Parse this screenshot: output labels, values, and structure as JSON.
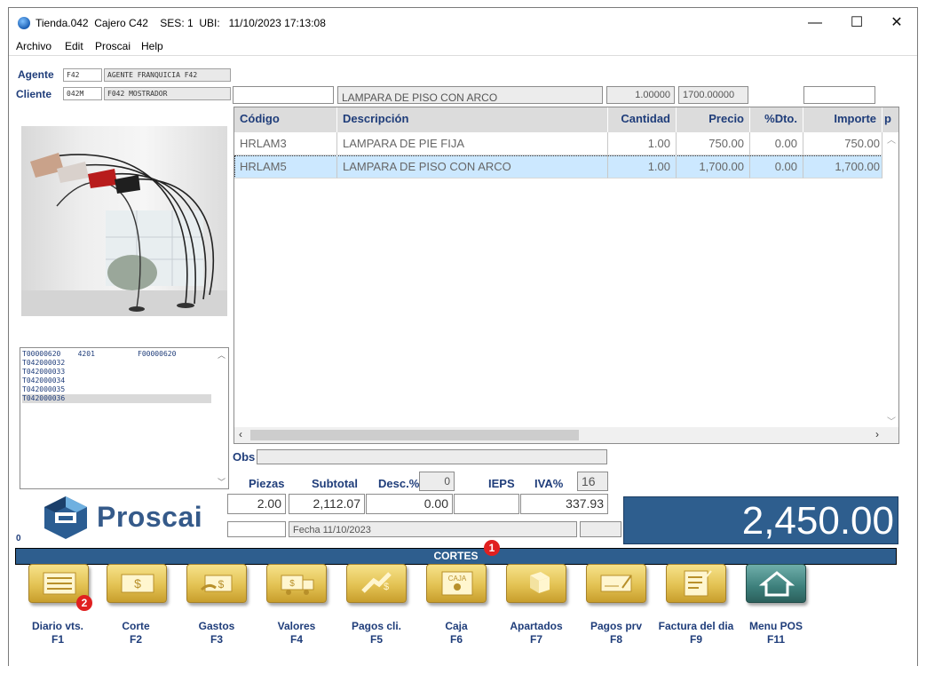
{
  "window": {
    "title": "Tienda.042  Cajero C42    SES: 1  UBI:   11/10/2023 17:13:08",
    "minimize": "—",
    "maximize": "☐",
    "close": "✕"
  },
  "menu": [
    "Archivo",
    "Edit",
    "Proscai",
    "Help"
  ],
  "header": {
    "agente_label": "Agente",
    "agente_code": "F42",
    "agente_name": "AGENTE FRANQUICIA F42",
    "cliente_label": "Cliente",
    "cliente_code": "042M",
    "cliente_name": "F042 MOSTRADOR"
  },
  "item_entry": {
    "code": "",
    "description": "LAMPARA DE PISO CON ARCO",
    "quantity": "1.00000",
    "price": "1700.00000",
    "extra": ""
  },
  "grid": {
    "columns": [
      "Código",
      "Descripción",
      "Cantidad",
      "Precio",
      "%Dto.",
      "Importe",
      "p"
    ],
    "rows": [
      {
        "codigo": "HRLAM3",
        "descripcion": "LAMPARA DE PIE FIJA",
        "cantidad": "1.00",
        "precio": "750.00",
        "dto": "0.00",
        "importe": "750.00"
      },
      {
        "codigo": "HRLAM5",
        "descripcion": "LAMPARA DE PISO CON ARCO",
        "cantidad": "1.00",
        "precio": "1,700.00",
        "dto": "0.00",
        "importe": "1,700.00"
      }
    ]
  },
  "tickets": [
    "T00000620    4201          F00000620",
    "T042000032",
    "T042000033",
    "T042000034",
    "T042000035",
    "T042000036"
  ],
  "obs_label": "Obs",
  "obs_value": "",
  "totals": {
    "piezas_label": "Piezas",
    "subtotal_label": "Subtotal",
    "desc_label": "Desc.%",
    "desc_pct": "0",
    "ieps_label": "IEPS",
    "iva_label": "IVA%",
    "iva_pct": "16",
    "piezas": "2.00",
    "subtotal": "2,112.07",
    "descuento": "0.00",
    "ieps": "",
    "iva": "337.93",
    "total": "2,450.00",
    "fecha": "Fecha 11/10/2023"
  },
  "logo": "Proscai",
  "counter": "0",
  "cortes_label": "CORTES",
  "badges": [
    "1",
    "2"
  ],
  "toolbar": [
    {
      "label": "Diario vts.",
      "key": "F1",
      "icon": "journal-icon"
    },
    {
      "label": "Corte",
      "key": "F2",
      "icon": "cash-bill-icon"
    },
    {
      "label": "Gastos",
      "key": "F3",
      "icon": "expense-icon"
    },
    {
      "label": "Valores",
      "key": "F4",
      "icon": "armored-truck-icon"
    },
    {
      "label": "Pagos cli.",
      "key": "F5",
      "icon": "customer-payment-icon"
    },
    {
      "label": "Caja",
      "key": "F6",
      "icon": "cash-register-icon"
    },
    {
      "label": "Apartados",
      "key": "F7",
      "icon": "layaway-box-icon"
    },
    {
      "label": "Pagos prv",
      "key": "F8",
      "icon": "check-payment-icon"
    },
    {
      "label": "Factura del dia",
      "key": "F9",
      "icon": "invoice-icon"
    },
    {
      "label": "Menu POS",
      "key": "F11",
      "icon": "home-icon"
    }
  ],
  "colors": {
    "accent_blue": "#2e5e8e",
    "label_blue": "#1f3d7a",
    "button_gold": "#e3c253",
    "button_teal": "#3c7f7b",
    "badge_red": "#e02020",
    "selection": "#cce8ff"
  }
}
